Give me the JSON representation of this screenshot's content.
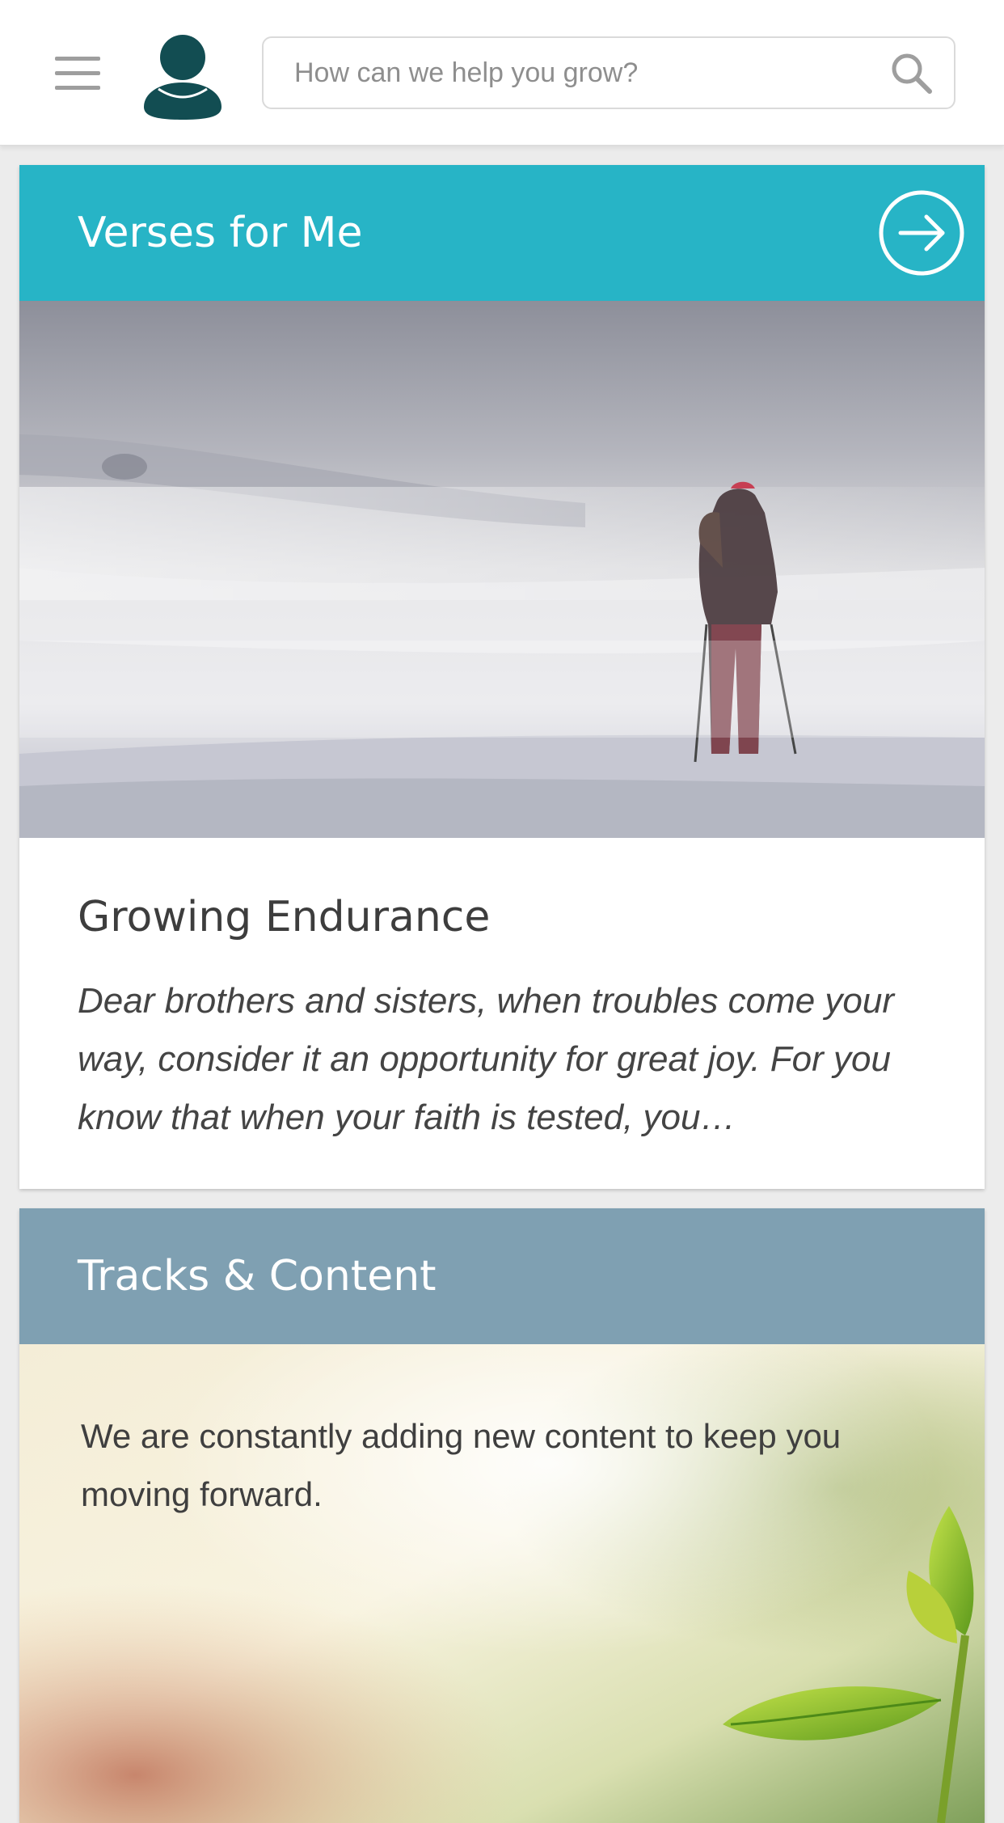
{
  "header": {
    "search_placeholder": "How can we help you grow?",
    "menu_icon": "hamburger-menu-icon",
    "avatar_icon": "user-avatar-icon",
    "search_icon": "search-icon"
  },
  "cards": [
    {
      "title": "Verses for Me",
      "header_color": "#27b4c6",
      "action_icon": "arrow-right-circle-icon",
      "image_description_icon": "snowstorm-hiker-image",
      "verse_title": "Growing Endurance",
      "verse_text": "Dear brothers and sisters, when troubles come your way, consider it an opportunity for great joy. For you know that when your faith is tested, you…"
    },
    {
      "title": "Tracks & Content",
      "header_color": "#7fa0b2",
      "image_description_icon": "sprouting-leaf-image",
      "body": "We are constantly adding new content to keep you moving forward."
    }
  ],
  "colors": {
    "avatar": "#124d52",
    "icon_gray": "#9e9e9e"
  }
}
